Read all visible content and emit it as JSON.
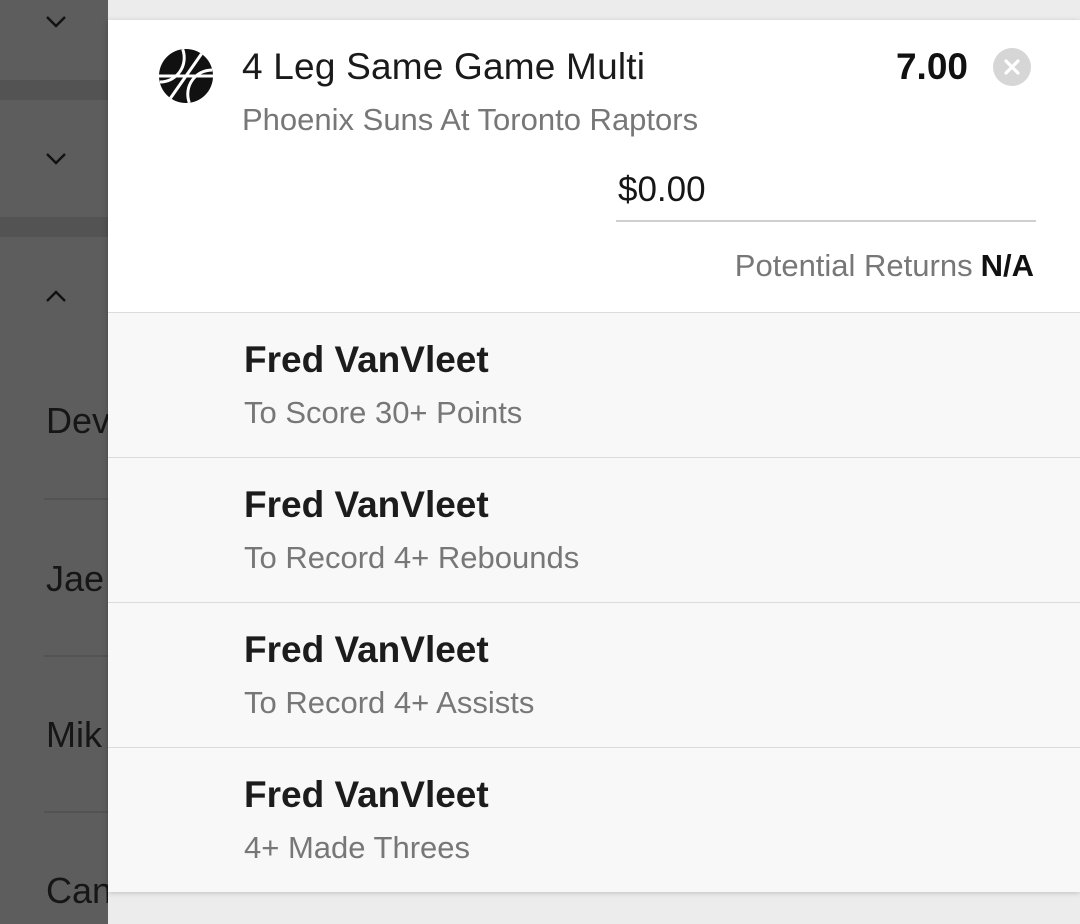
{
  "background_list": {
    "rows": [
      {
        "chevron": "chevron-down-icon"
      },
      {
        "chevron": "chevron-down-icon"
      },
      {
        "chevron": "chevron-up-icon"
      }
    ],
    "names": [
      "Dev",
      "Jae",
      "Mik",
      "Can"
    ]
  },
  "bet": {
    "icon": "basketball-icon",
    "title": "4 Leg Same Game Multi",
    "odds": "7.00",
    "event": "Phoenix Suns At Toronto Raptors",
    "stake_value": "$0.00",
    "returns_label": "Potential Returns",
    "returns_value": "N/A",
    "close_icon": "close-icon"
  },
  "legs": [
    {
      "player": "Fred VanVleet",
      "market": "To Score 30+ Points"
    },
    {
      "player": "Fred VanVleet",
      "market": "To Record 4+ Rebounds"
    },
    {
      "player": "Fred VanVleet",
      "market": "To Record 4+ Assists"
    },
    {
      "player": "Fred VanVleet",
      "market": "4+ Made Threes"
    }
  ],
  "colors": {
    "overlay": "#5d5d5d",
    "card": "#ffffff",
    "leg_bg": "#f8f8f8",
    "muted_text": "#777777",
    "close_bg": "#d6d6d6"
  }
}
